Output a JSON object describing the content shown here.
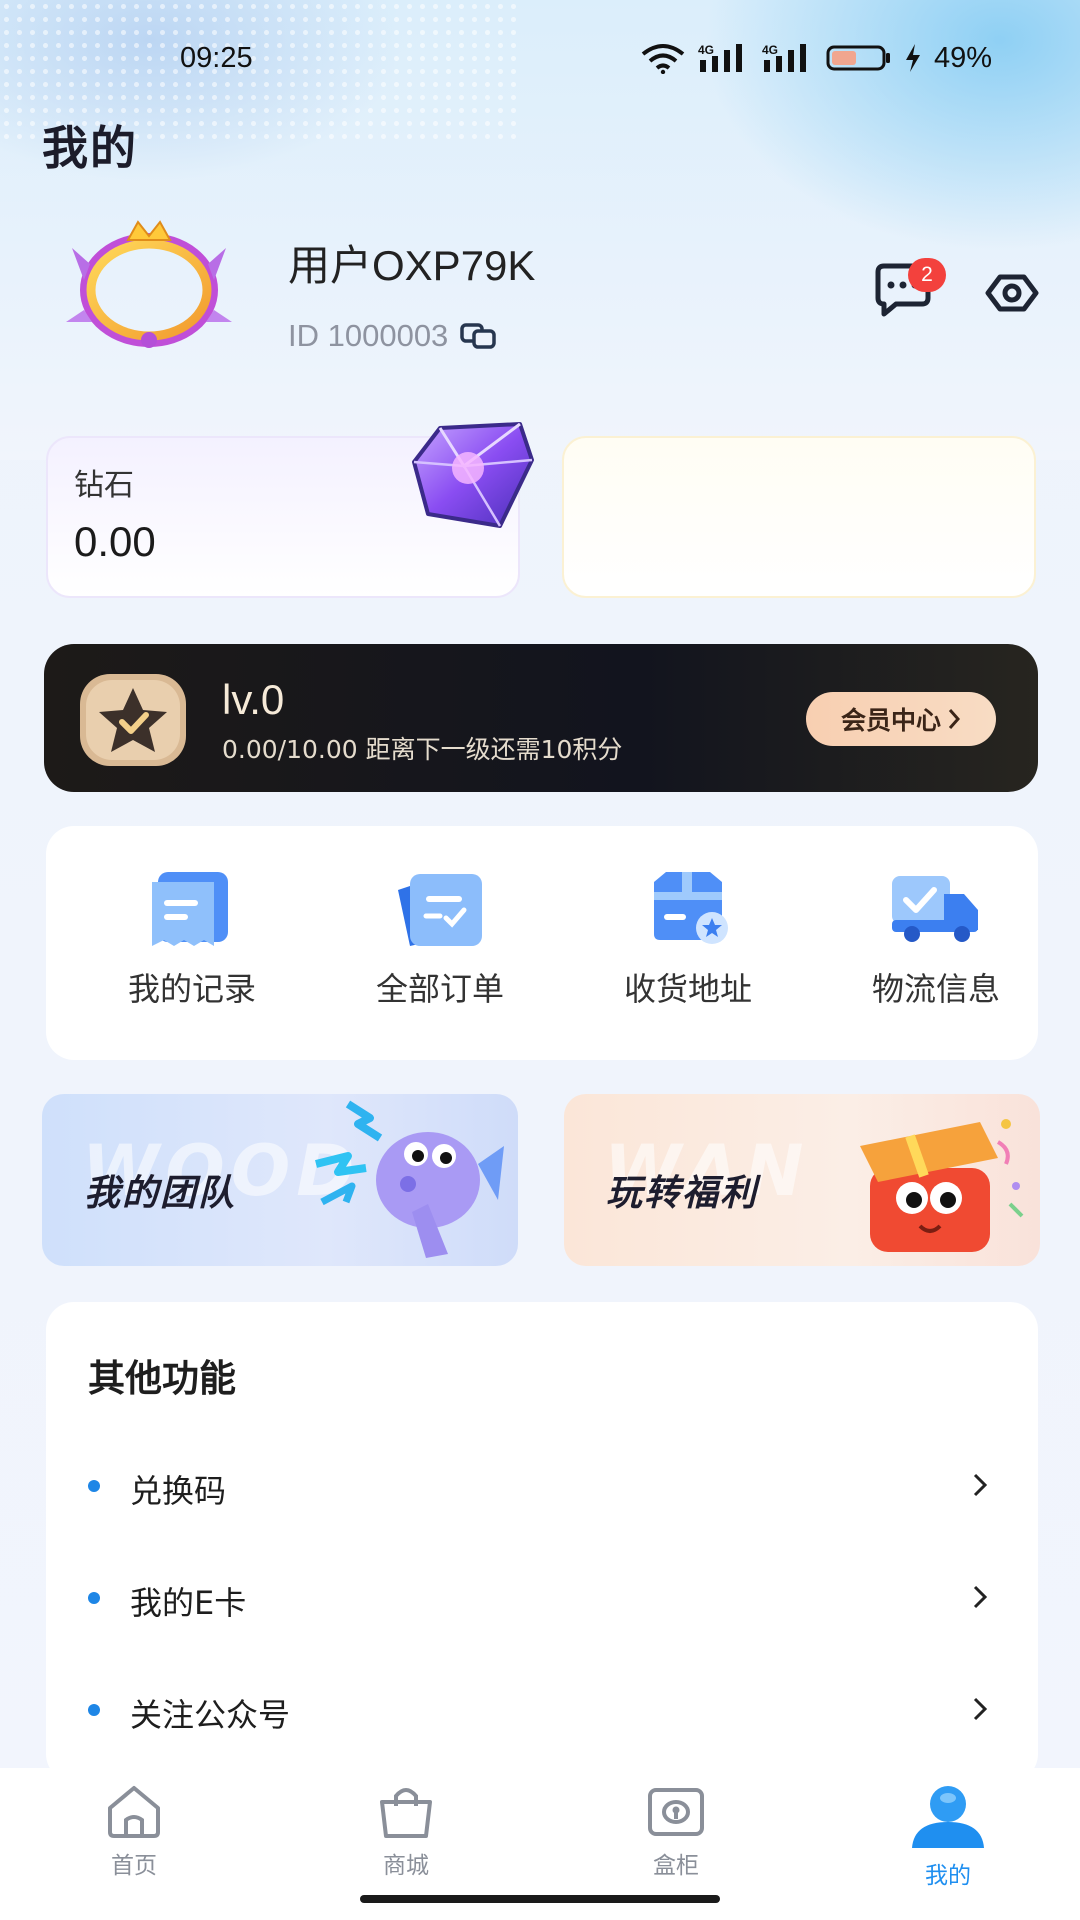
{
  "status_bar": {
    "time": "09:25",
    "battery": "49%",
    "network_labels": [
      "4G",
      "4G"
    ]
  },
  "header": {
    "title": "我的"
  },
  "profile": {
    "name": "用户OXP79K",
    "id_text": "ID 1000003",
    "message_badge": "2"
  },
  "assets": {
    "diamond_label": "钻石",
    "diamond_value": "0.00"
  },
  "vip": {
    "level": "lv.0",
    "progress_text": "0.00/10.00 距离下一级还需10积分",
    "member_center_label": "会员中心",
    "progress_fraction": 0.0
  },
  "quick_actions": [
    {
      "label": "我的记录",
      "icon": "records-icon"
    },
    {
      "label": "全部订单",
      "icon": "orders-icon"
    },
    {
      "label": "收货地址",
      "icon": "address-icon"
    },
    {
      "label": "物流信息",
      "icon": "logistics-icon"
    }
  ],
  "promos": {
    "team": {
      "title": "我的团队",
      "watermark": "WOOD"
    },
    "welfare": {
      "title": "玩转福利",
      "watermark": "WAN"
    }
  },
  "other": {
    "title": "其他功能",
    "items": [
      {
        "label": "兑换码"
      },
      {
        "label": "我的E卡"
      },
      {
        "label": "关注公众号"
      }
    ]
  },
  "tabs": [
    {
      "label": "首页",
      "icon": "home-icon",
      "active": false
    },
    {
      "label": "商城",
      "icon": "shopping-bag-icon",
      "active": false
    },
    {
      "label": "盒柜",
      "icon": "box-cabinet-icon",
      "active": false
    },
    {
      "label": "我的",
      "icon": "profile-icon",
      "active": true
    }
  ],
  "colors": {
    "accent": "#1f8ff0",
    "badge": "#f3413d",
    "vip_button": "#f8d2b6",
    "bullet": "#1e86e6"
  }
}
